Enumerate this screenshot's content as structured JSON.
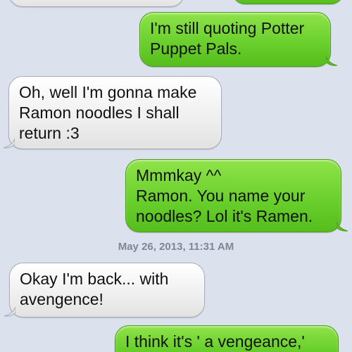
{
  "conversation": {
    "timestamp": "May 26, 2013, 11:31 AM",
    "messages": [
      {
        "direction": "sent",
        "lines": [
          "I'm still quoting Potter",
          "Puppet Pals."
        ]
      },
      {
        "direction": "received",
        "lines": [
          "Oh, well I'm gonna make",
          "Ramon noodles I shall",
          "return :3"
        ]
      },
      {
        "direction": "sent",
        "lines": [
          "Mmmkay ^^",
          "Ramon. You name your",
          "noodles? Lol it's Ramen."
        ]
      },
      {
        "direction": "received",
        "lines": [
          "Okay I'm back... with",
          "avengence!"
        ]
      },
      {
        "direction": "sent",
        "lines": [
          "I think it's ' a vengeance,'"
        ]
      }
    ]
  },
  "colors": {
    "background": "#dbe2ed",
    "sent_bubble": "#6ad02c",
    "received_bubble": "#f0f0f0",
    "timestamp_text": "#7f8795"
  }
}
